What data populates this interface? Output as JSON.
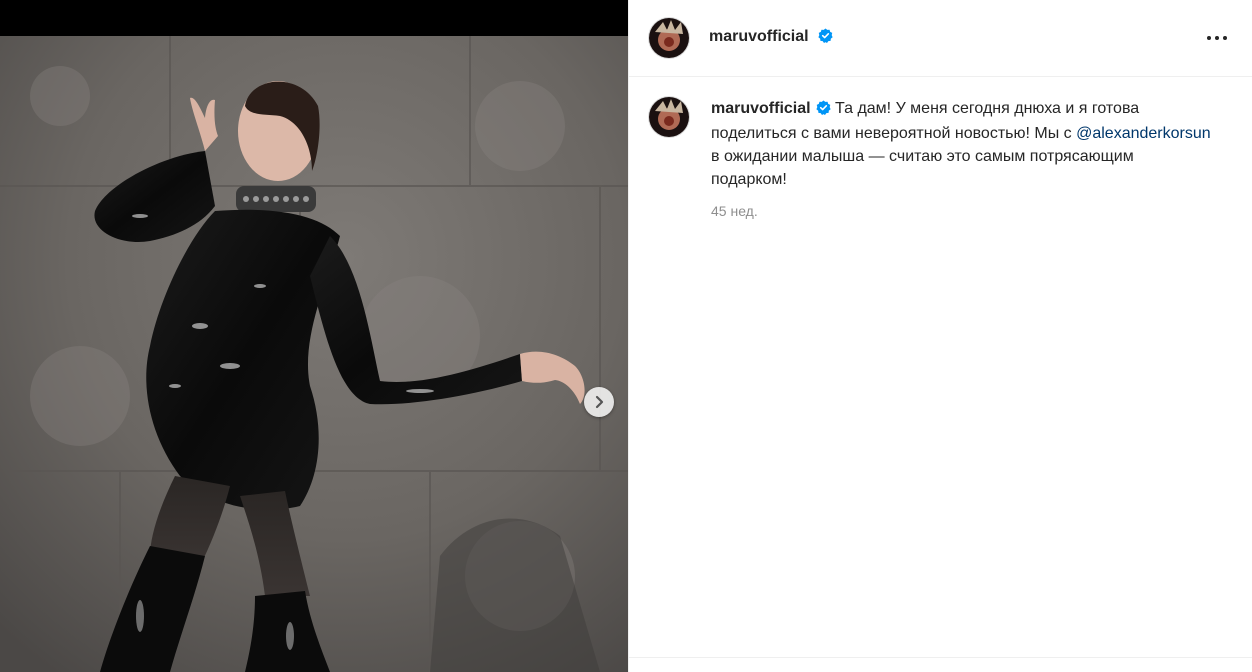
{
  "post": {
    "username": "maruvofficial",
    "verified_icon": "verified-badge-icon",
    "more_icon": "more-options-icon",
    "caption": {
      "username": "maruvofficial",
      "part1": " Та дам! У меня сегодня днюха и я готова поделиться с вами невероятной новостью! Мы с ",
      "mention": "@alexanderkorsun",
      "part2": " в ожидании малыша — считаю это самым потрясающим подарком!"
    },
    "timestamp": "45 нед."
  },
  "media": {
    "next_icon": "chevron-right-icon",
    "description_icon": "photo"
  },
  "colors": {
    "text": "#262626",
    "muted": "#8e8e8e",
    "link": "#00376b",
    "verified": "#0095f6",
    "divider": "#efefef"
  }
}
